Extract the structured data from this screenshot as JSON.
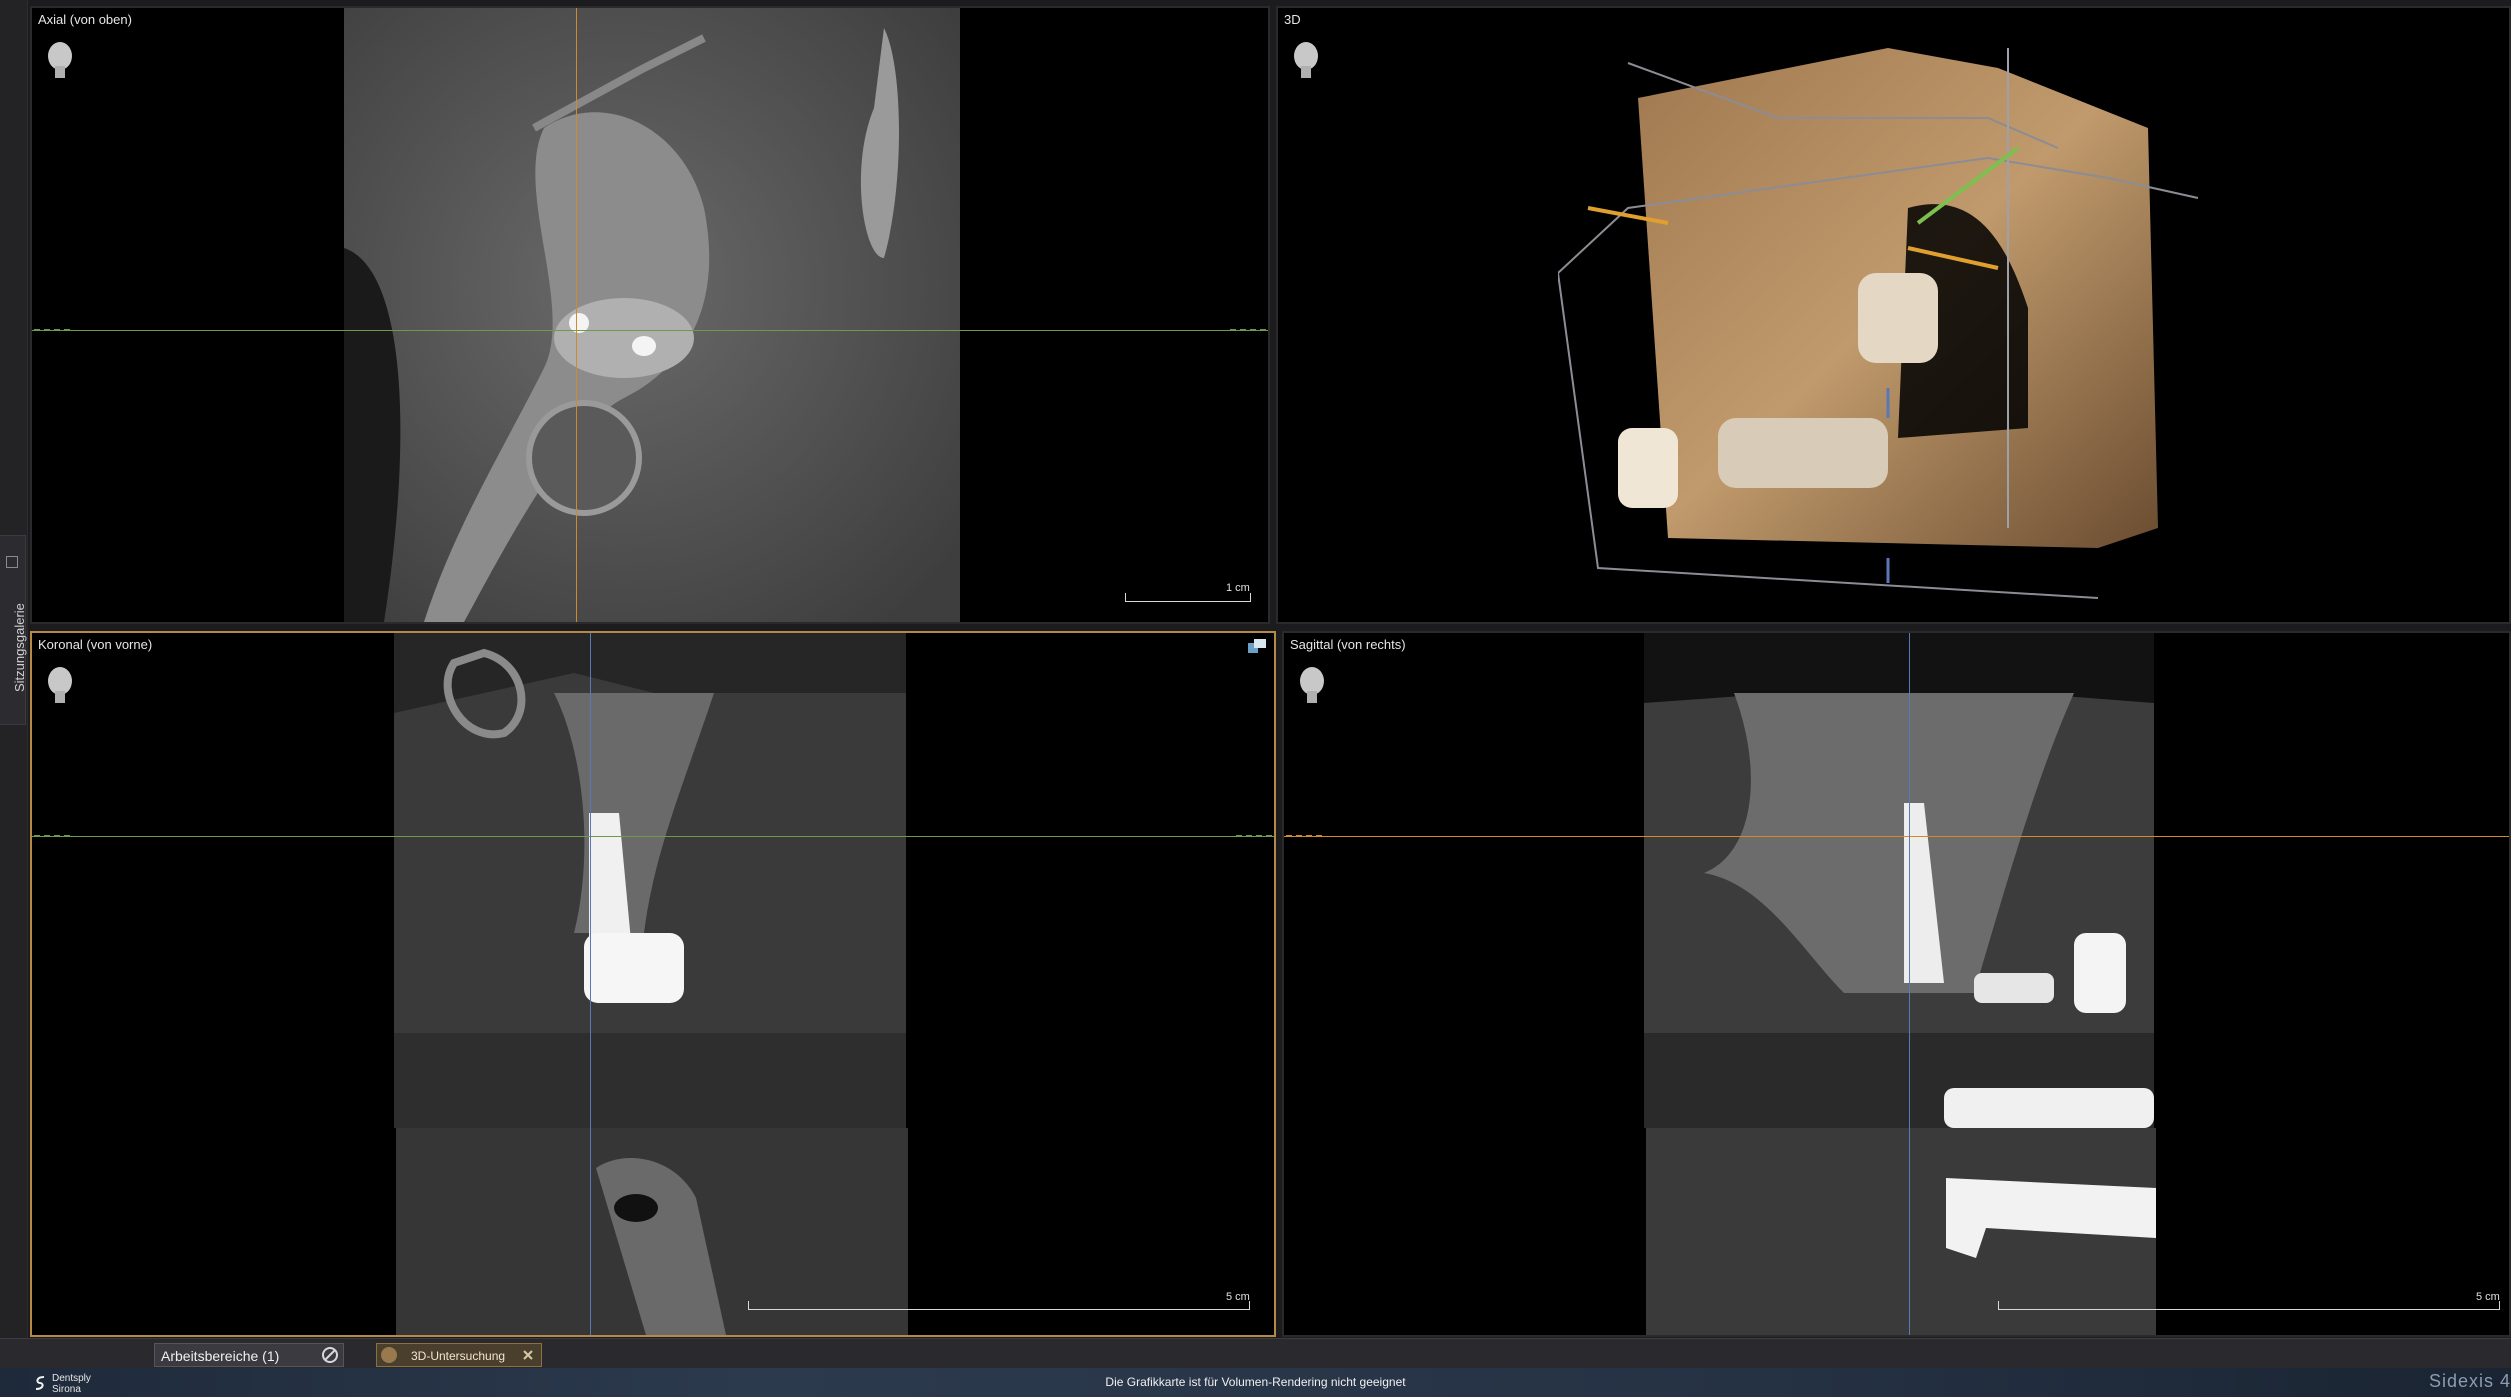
{
  "sidebar": {
    "tab_label": "Sitzungsgalerie"
  },
  "viewports": {
    "axial": {
      "title": "Axial (von oben)",
      "scale_label": "1 cm"
    },
    "three_d": {
      "title": "3D"
    },
    "coronal": {
      "title": "Koronal (von vorne)",
      "scale_label": "5 cm"
    },
    "sagittal": {
      "title": "Sagittal (von rechts)",
      "scale_label": "5 cm"
    }
  },
  "tabs": {
    "workspaces_label": "Arbeitsbereiche (1)",
    "exam_label": "3D-Untersuchung"
  },
  "status": {
    "brand_line1": "Dentsply",
    "brand_line2": "Sirona",
    "message": "Die Grafikkarte ist für Volumen-Rendering nicht geeignet",
    "app_name": "Sidexis 4"
  },
  "colors": {
    "active_border": "#b58a47",
    "crosshair_green": "#6e9a4a",
    "crosshair_orange": "#d08a2a",
    "crosshair_blue": "#5a78b8"
  },
  "icons": [
    "head-orientation-icon",
    "viewport-menu-icon",
    "workspace-tool-icon",
    "exam-avatar-icon",
    "close-icon",
    "dentsply-logo-icon"
  ]
}
